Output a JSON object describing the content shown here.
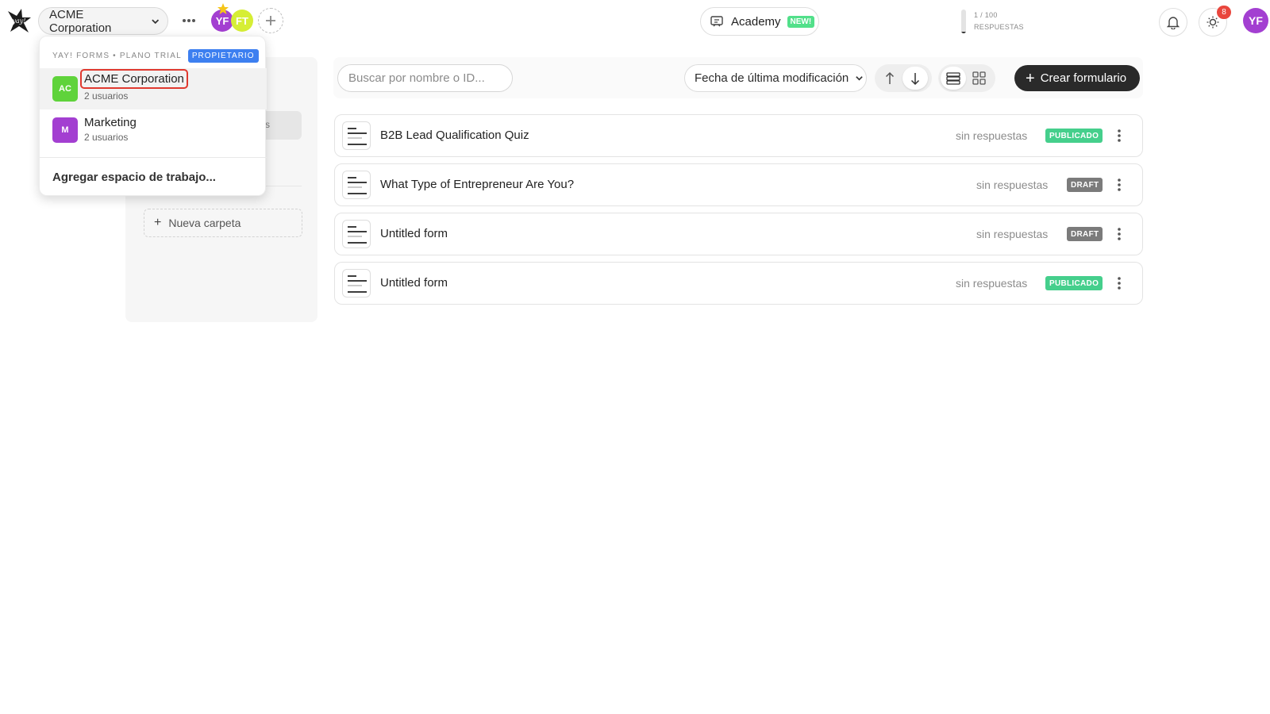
{
  "topbar": {
    "workspace_name": "ACME Corporation",
    "members": [
      {
        "initials": "YF",
        "color": "#a33fd1"
      },
      {
        "initials": "FT",
        "color": "#d6ee35"
      }
    ],
    "academy_label": "Academy",
    "academy_badge": "NEW!",
    "responses_count": "1 / 100",
    "responses_label": "RESPUESTAS",
    "responses_fraction": 0.01,
    "notification_count": "8",
    "user_initials": "YF"
  },
  "sidebar": {
    "new_folder_label": "Nueva carpeta"
  },
  "toolbar": {
    "search_placeholder": "Buscar por nombre o ID...",
    "sort_label": "Fecha de última modificación",
    "create_label": "Crear formulario"
  },
  "forms": [
    {
      "title": "B2B Lead Qualification Quiz",
      "responses": "sin respuestas",
      "status": "PUBLICADO"
    },
    {
      "title": "What Type of Entrepreneur Are You?",
      "responses": "sin respuestas",
      "status": "DRAFT"
    },
    {
      "title": "Untitled form",
      "responses": "sin respuestas",
      "status": "DRAFT"
    },
    {
      "title": "Untitled form",
      "responses": "sin respuestas",
      "status": "PUBLICADO"
    }
  ],
  "dropdown": {
    "header": "YAY! FORMS • PLANO TRIAL",
    "role": "PROPIETARIO",
    "workspaces": [
      {
        "badge": "AC",
        "name": "ACME Corporation",
        "users": "2 usuarios",
        "color": "#5fd33b"
      },
      {
        "badge": "M",
        "name": "Marketing",
        "users": "2 usuarios",
        "color": "#a33fd1"
      }
    ],
    "add_label": "Agregar espacio de trabajo..."
  },
  "colors": {
    "accent_dark": "#2a2a2a",
    "published": "#45cf8c",
    "draft": "#7b7b7b",
    "role_badge": "#3d7ff0",
    "highlight": "#e0392f"
  }
}
